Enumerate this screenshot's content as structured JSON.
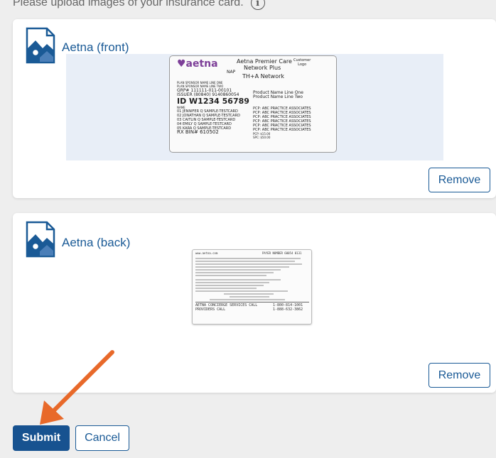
{
  "instruction": {
    "text": "Please upload images of your insurance card.",
    "info_icon": "i"
  },
  "uploads": [
    {
      "file_name": "Aetna (front)",
      "remove_label": "Remove",
      "card_front": {
        "logo": "♥aetna",
        "network_line1": "Aetna Premier Care",
        "network_line2": "Network Plus",
        "customer_logo": "Customer\nLogo",
        "nap": "NAP",
        "th_network": "TH+A Network",
        "sponsor1": "PLAN SPONSOR NAME LINE ONE",
        "sponsor2": "PLAN SPONSOR NAME LINE TWO",
        "grp": "GRP#  111111-011-00101",
        "issuer": "ISSUER (80840) 9140860054",
        "product1": "Product Name Line One",
        "product2": "Product Name Line Two",
        "id": "ID W1234 56789",
        "name_label": "NAME",
        "members": [
          "01 JENNIFER Q SAMPLE-TESTCARD",
          "02 JONATHAN Q SAMPLE-TESTCARD",
          "03 CAITLIN Q SAMPLE-TESTCARD",
          "04 EMILY Q SAMPLE-TESTCARD",
          "05 KARA Q SAMPLE-TESTCARD"
        ],
        "pcp": [
          "PCP: ABC PRACTICE ASSOCIATES",
          "PCP: ABC PRACTICE ASSOCIATES",
          "PCP: ABC PRACTICE ASSOCIATES",
          "PCP: ABC PRACTICE ASSOCIATES",
          "PCP: ABC PRACTICE ASSOCIATES",
          "PCP: ABC PRACTICE ASSOCIATES"
        ],
        "rx_bin": "RX BIN# 610502",
        "copay1": "PCP: $15.00",
        "copay2": "SPC: $50.00"
      }
    },
    {
      "file_name": "Aetna (back)",
      "remove_label": "Remove",
      "card_back": {
        "website": "www.aetna.com",
        "payer_number": "PAYER NUMBER 60054 0131",
        "concierge": "AETNA CONCIERGE SERVICES CALL",
        "concierge_phone": "1-800-814-1001",
        "providers": "PROVIDERS CALL",
        "providers_phone": "1-888-632-3862"
      }
    }
  ],
  "actions": {
    "submit_label": "Submit",
    "cancel_label": "Cancel"
  },
  "colors": {
    "primary": "#175290",
    "link": "#1a5a96",
    "arrow": "#e8692a",
    "background": "#eeeeee"
  }
}
